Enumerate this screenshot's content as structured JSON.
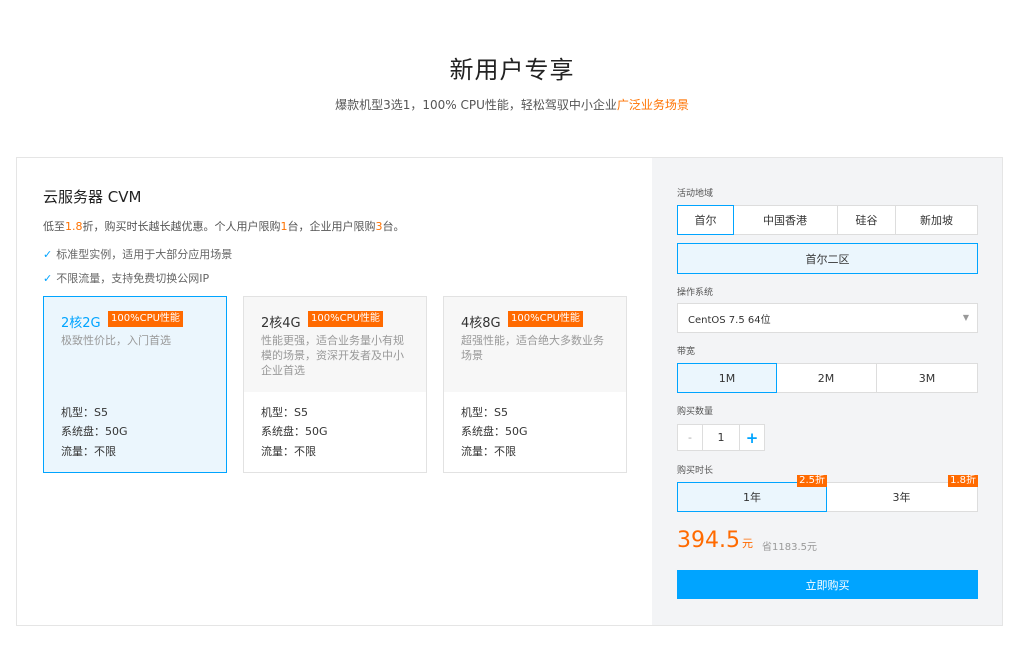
{
  "hero": {
    "title": "新用户专享",
    "subtitle_prefix": "爆款机型3选1，100% CPU性能，轻松驾驭中小企业",
    "subtitle_highlight": "广泛业务场景"
  },
  "product": {
    "title": "云服务器 CVM",
    "desc_1": "低至",
    "desc_discount": "1.8",
    "desc_2": "折，购买时长越长越优惠。个人用户限购",
    "desc_personal": "1",
    "desc_3": "台，企业用户限购",
    "desc_enterprise": "3",
    "desc_4": "台。",
    "features": [
      "标准型实例，适用于大部分应用场景",
      "不限流量，支持免费切换公网IP"
    ]
  },
  "cards": [
    {
      "spec": "2核2G",
      "tag": "100%CPU性能",
      "desc": "极致性价比，入门首选",
      "model": "机型：S5",
      "disk": "系统盘：50G",
      "traffic": "流量：不限"
    },
    {
      "spec": "2核4G",
      "tag": "100%CPU性能",
      "desc": "性能更强，适合业务量小有规模的场景，资深开发者及中小企业首选",
      "model": "机型：S5",
      "disk": "系统盘：50G",
      "traffic": "流量：不限"
    },
    {
      "spec": "4核8G",
      "tag": "100%CPU性能",
      "desc": "超强性能，适合绝大多数业务场景",
      "model": "机型：S5",
      "disk": "系统盘：50G",
      "traffic": "流量：不限"
    }
  ],
  "config": {
    "region_label": "活动地域",
    "regions": [
      "首尔",
      "中国香港",
      "硅谷",
      "新加坡"
    ],
    "zone": "首尔二区",
    "os_label": "操作系统",
    "os_value": "CentOS 7.5 64位",
    "bandwidth_label": "带宽",
    "bandwidths": [
      "1M",
      "2M",
      "3M"
    ],
    "qty_label": "购买数量",
    "qty_minus": "-",
    "qty_value": "1",
    "qty_plus": "+",
    "duration_label": "购买时长",
    "durations": [
      {
        "label": "1年",
        "badge": "2.5折"
      },
      {
        "label": "3年",
        "badge": "1.8折"
      }
    ],
    "price": "394.5",
    "price_unit": "元",
    "save": "省1183.5元",
    "buy": "立即购买"
  },
  "colors": {
    "accent": "#00a4ff",
    "orange": "#ff6a00"
  }
}
